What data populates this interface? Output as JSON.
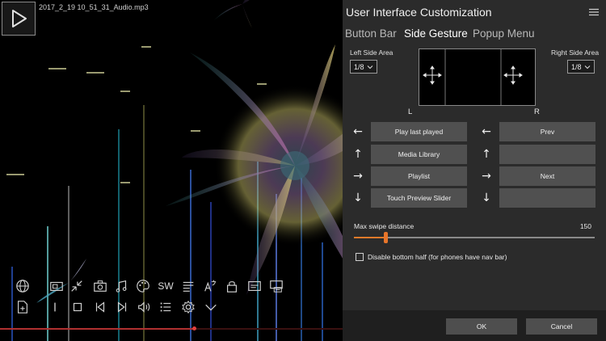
{
  "player": {
    "file_name": "2017_2_19 10_51_31_Audio.mp3",
    "text_button_sw": "SW",
    "seek_progress": 0.565,
    "toolbar_row1_icons": [
      "globe-icon",
      "aspect-ratio-icon",
      "compress-icon",
      "camera-icon",
      "music-notes-icon",
      "palette-icon",
      "sw-text-icon",
      "playlist-menu-icon",
      "translate-text-icon",
      "lock-icon",
      "subtitle-icon",
      "screen-record-icon"
    ],
    "toolbar_row2_icons": [
      "add-file-icon",
      "pause-icon",
      "stop-icon",
      "previous-icon",
      "next-icon",
      "volume-icon",
      "list-icon",
      "settings-gear-icon",
      "chevron-down-icon"
    ]
  },
  "dialog": {
    "title": "User Interface Customization",
    "tabs": [
      {
        "label": "Button Bar",
        "active": false
      },
      {
        "label": "Side Gesture",
        "active": true
      },
      {
        "label": "Popup Menu",
        "active": false
      }
    ],
    "left_side_area": {
      "label": "Left Side Area",
      "value": "1/8"
    },
    "right_side_area": {
      "label": "Right Side Area",
      "value": "1/8"
    },
    "left_col_label": "L",
    "right_col_label": "R",
    "gestures": [
      {
        "arrow": "←",
        "left_action": "Play last played",
        "right_action": "Prev"
      },
      {
        "arrow": "↑",
        "left_action": "Media Library",
        "right_action": ""
      },
      {
        "arrow": "→",
        "left_action": "Playlist",
        "right_action": "Next"
      },
      {
        "arrow": "↓",
        "left_action": "Touch Preview Slider",
        "right_action": ""
      }
    ],
    "swipe": {
      "label": "Max swipe distance",
      "value": "150",
      "fraction": 0.13
    },
    "checkbox": {
      "label": "Disable bottom half (for phones have nav bar)",
      "checked": false
    },
    "ok_label": "OK",
    "cancel_label": "Cancel"
  },
  "colors": {
    "panel_bg": "#2b2b2b",
    "button_bg": "#505050",
    "accent_orange": "#e8752a",
    "seek_red": "#b03030"
  }
}
